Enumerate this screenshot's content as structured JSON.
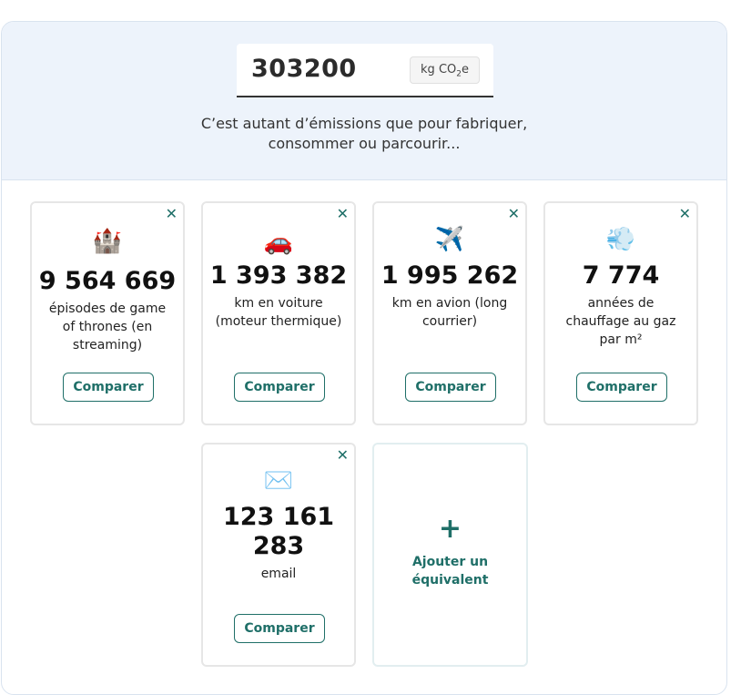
{
  "header": {
    "value": "303200",
    "unit_prefix": "kg CO",
    "unit_sub": "2",
    "unit_suffix": "e",
    "intro_line1": "C’est autant d’émissions que pour fabriquer,",
    "intro_line2": "consommer ou parcourir..."
  },
  "cards": [
    {
      "emoji": "🏰",
      "number": "9 564 669",
      "label": "épisodes de game of thrones (en streaming)",
      "compare": "Comparer",
      "close": "✕"
    },
    {
      "emoji": "🚗",
      "number": "1 393 382",
      "label": "km en voiture (moteur thermique)",
      "compare": "Comparer",
      "close": "✕"
    },
    {
      "emoji": "✈️",
      "number": "1 995 262",
      "label": "km en avion (long courrier)",
      "compare": "Comparer",
      "close": "✕"
    },
    {
      "emoji": "💨",
      "number": "7 774",
      "label": "années de chauffage au gaz par m²",
      "compare": "Comparer",
      "close": "✕"
    },
    {
      "emoji": "✉️",
      "number": "123 161 283",
      "label": "email",
      "compare": "Comparer",
      "close": "✕"
    }
  ],
  "add": {
    "plus": "+",
    "label": "Ajouter un équivalent"
  },
  "colors": {
    "accent": "#1f6f68",
    "top_bg": "#edf3fb"
  }
}
